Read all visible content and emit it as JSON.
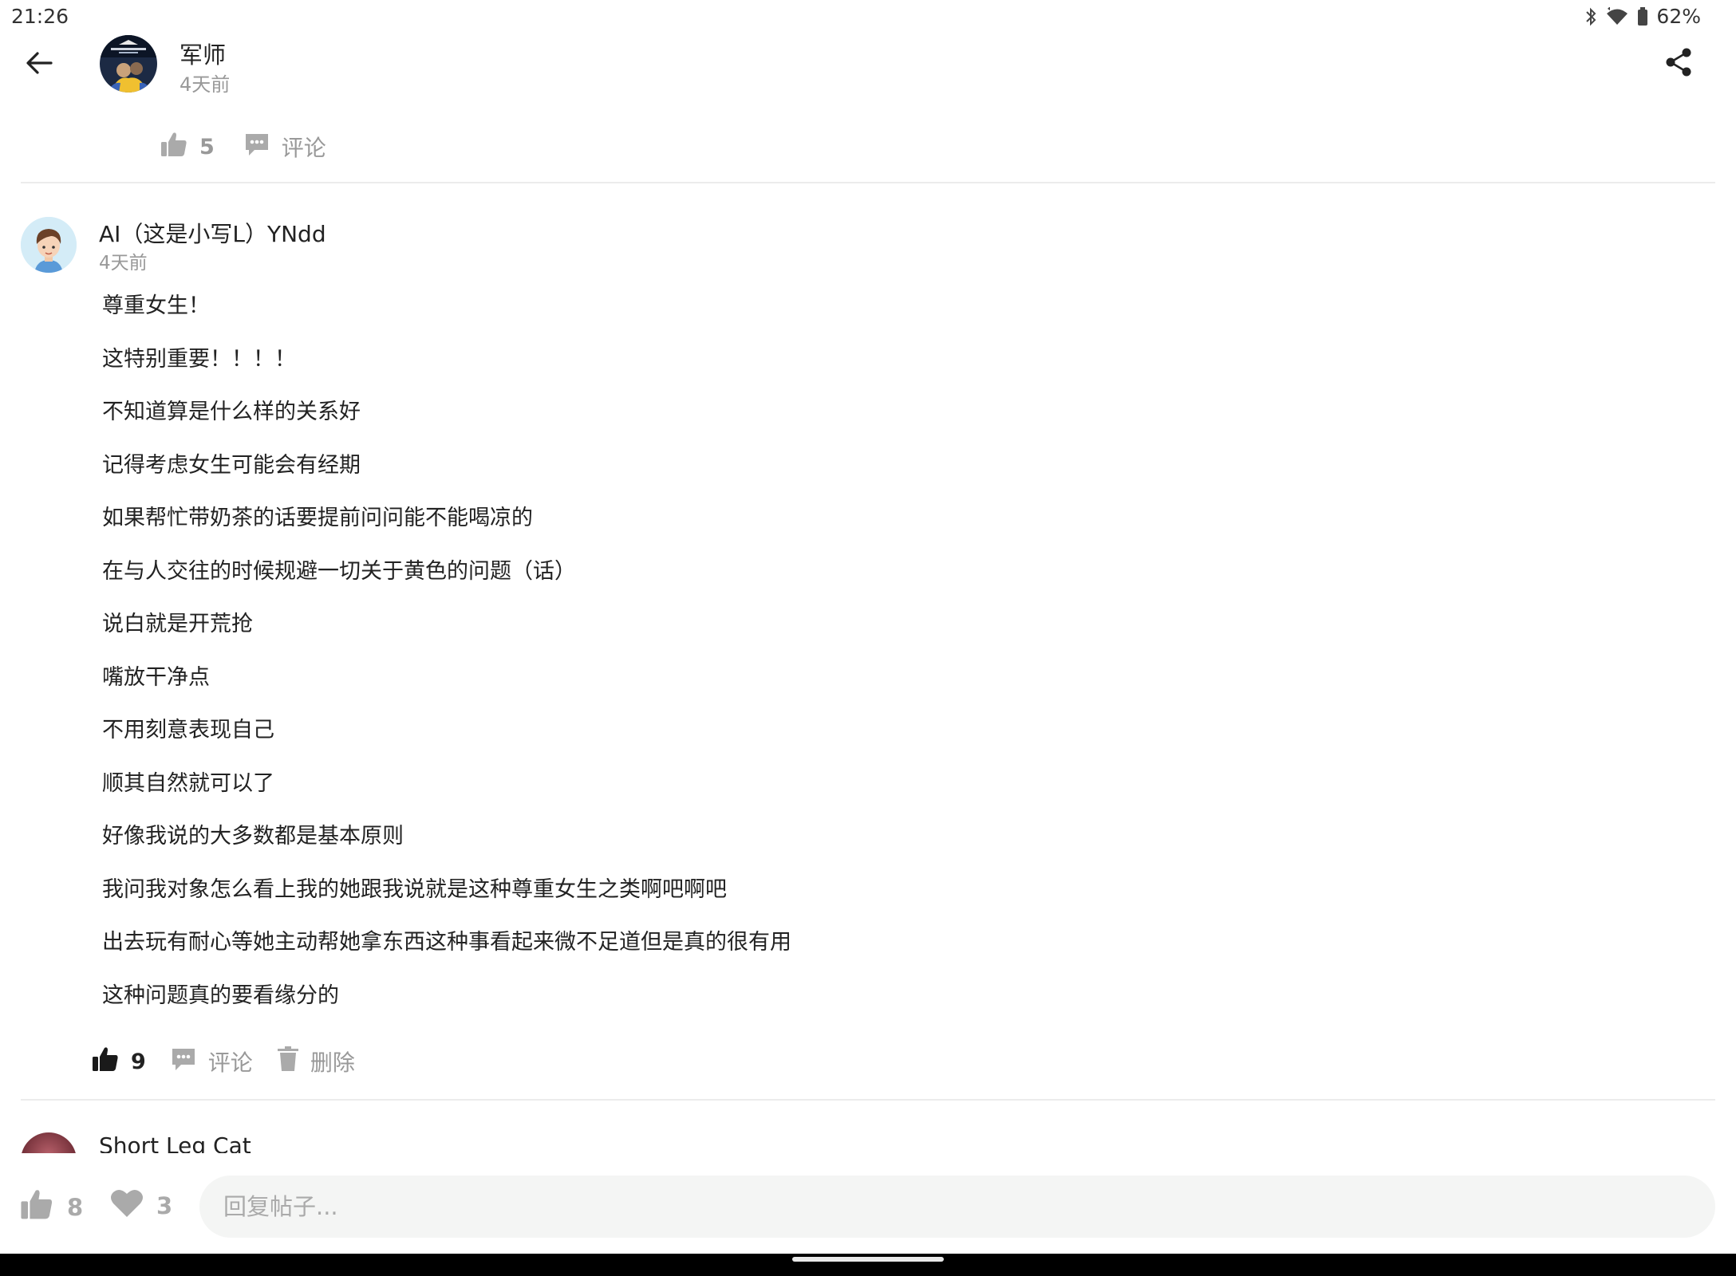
{
  "status_bar": {
    "time": "21:26",
    "battery": "62%",
    "icons": [
      "bluetooth-icon",
      "wifi-icon",
      "battery-icon"
    ]
  },
  "header": {
    "back_icon": "arrow-left-icon",
    "author_name": "军师",
    "author_time": "4天前",
    "share_icon": "share-icon"
  },
  "post_actions": {
    "like_count": "5",
    "comment_label": "评论"
  },
  "comment": {
    "author": "AI（这是小写L）YNdd",
    "time": "4天前",
    "lines": [
      "尊重女生！",
      "这特别重要！！！！",
      "不知道算是什么样的关系好",
      "记得考虑女生可能会有经期",
      "如果帮忙带奶茶的话要提前问问能不能喝凉的",
      "在与人交往的时候规避一切关于黄色的问题（话）",
      "说白就是开荒抢",
      "嘴放干净点",
      "不用刻意表现自己",
      "顺其自然就可以了",
      "好像我说的大多数都是基本原则",
      "我问我对象怎么看上我的她跟我说就是这种尊重女生之类啊吧啊吧",
      "出去玩有耐心等她主动帮她拿东西这种事看起来微不足道但是真的很有用",
      "这种问题真的要看缘分的"
    ],
    "like_count": "9",
    "comment_label": "评论",
    "delete_label": "删除"
  },
  "next_comment": {
    "author": "Short Leg Cat"
  },
  "bottom_bar": {
    "like_count": "8",
    "favorite_count": "3",
    "reply_placeholder": "回复帖子..."
  },
  "colors": {
    "muted": "#999999",
    "text": "#222222",
    "input_bg": "#f4f5f4",
    "divider": "#ececec"
  }
}
